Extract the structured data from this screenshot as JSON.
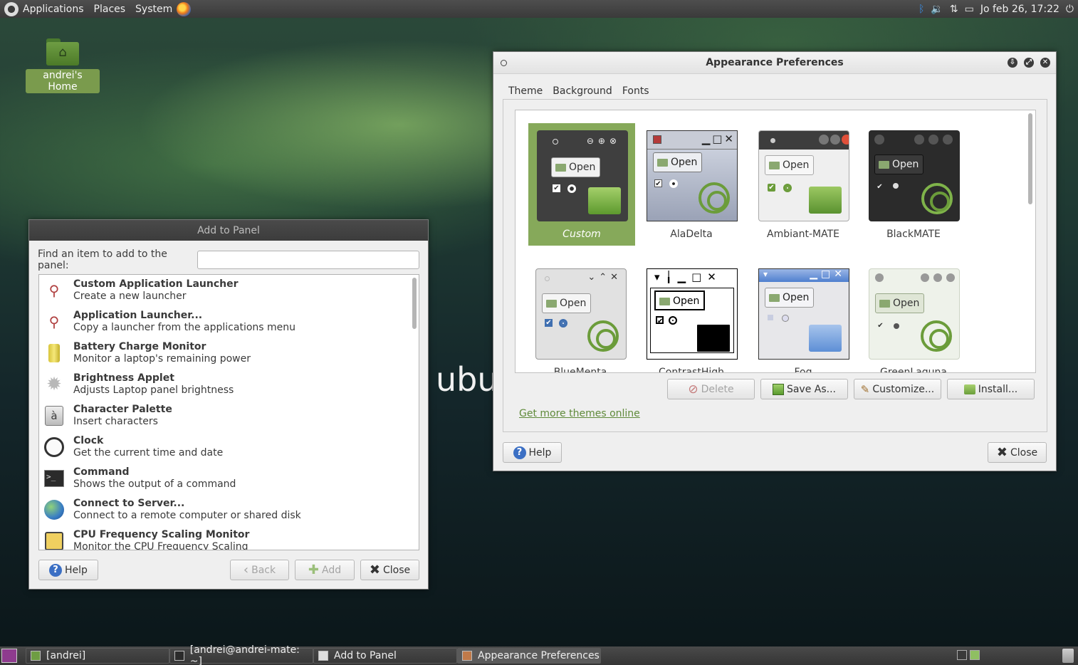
{
  "top_panel": {
    "menus": [
      "Applications",
      "Places",
      "System"
    ],
    "datetime": "Jo feb 26, 17:22"
  },
  "desktop": {
    "home_label": "andrei's Home",
    "wallpaper_text": "ubu"
  },
  "add_to_panel": {
    "title": "Add to Panel",
    "find_label": "Find an item to add to the panel:",
    "find_value": "",
    "items": [
      {
        "title": "Custom Application Launcher",
        "desc": "Create a new launcher",
        "icon": "launcher-icon"
      },
      {
        "title": "Application Launcher...",
        "desc": "Copy a launcher from the applications menu",
        "icon": "launcher-icon"
      },
      {
        "title": "Battery Charge Monitor",
        "desc": "Monitor a laptop's remaining power",
        "icon": "battery-icon"
      },
      {
        "title": "Brightness Applet",
        "desc": "Adjusts Laptop panel brightness",
        "icon": "brightness-icon"
      },
      {
        "title": "Character Palette",
        "desc": "Insert characters",
        "icon": "character-icon"
      },
      {
        "title": "Clock",
        "desc": "Get the current time and date",
        "icon": "clock-icon"
      },
      {
        "title": "Command",
        "desc": "Shows the output of a command",
        "icon": "terminal-icon"
      },
      {
        "title": "Connect to Server...",
        "desc": "Connect to a remote computer or shared disk",
        "icon": "globe-icon"
      },
      {
        "title": "CPU Frequency Scaling Monitor",
        "desc": "Monitor the CPU Frequency Scaling",
        "icon": "cpu-icon"
      }
    ],
    "buttons": {
      "help": "Help",
      "back": "Back",
      "add": "Add",
      "close": "Close"
    }
  },
  "appearance": {
    "title": "Appearance Preferences",
    "tabs": [
      "Theme",
      "Background",
      "Fonts"
    ],
    "active_tab": "Theme",
    "themes": [
      {
        "name": "Custom",
        "selected": true
      },
      {
        "name": "AlaDelta",
        "selected": false
      },
      {
        "name": "Ambiant-MATE",
        "selected": false
      },
      {
        "name": "BlackMATE",
        "selected": false
      },
      {
        "name": "BlueMenta",
        "selected": false
      },
      {
        "name": "ContrastHigh",
        "selected": false
      },
      {
        "name": "Fog",
        "selected": false
      },
      {
        "name": "GreenLaguna",
        "selected": false
      }
    ],
    "preview_button_label": "Open",
    "check_mark": "✔",
    "buttons": {
      "delete": "Delete",
      "save_as": "Save As...",
      "customize": "Customize...",
      "install": "Install...",
      "help": "Help",
      "close": "Close"
    },
    "more_themes_link": "Get more themes online"
  },
  "taskbar": {
    "tasks": [
      "[andrei]",
      "[andrei@andrei-mate: ~]",
      "Add to Panel",
      "Appearance Preferences"
    ]
  },
  "colors": {
    "accent": "#86a95a",
    "link": "#5f8a3a",
    "panel": "#3c3c3c"
  }
}
